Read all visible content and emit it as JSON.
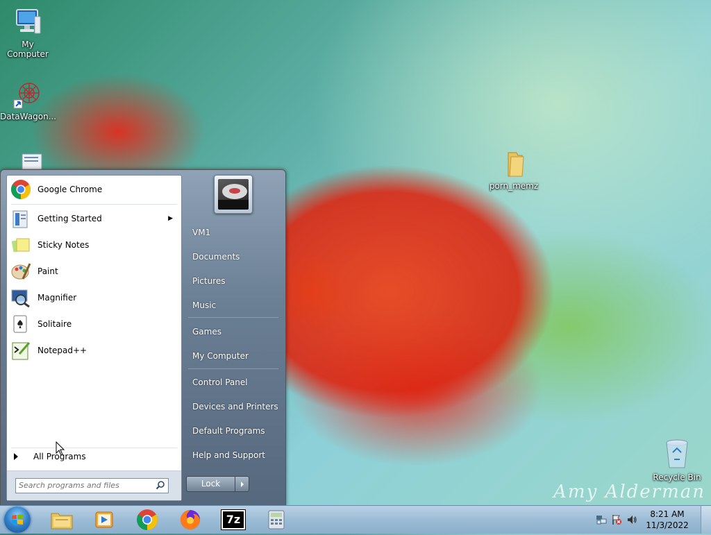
{
  "desktop": {
    "icons": [
      {
        "label": "My Computer",
        "icon": "computer-icon"
      },
      {
        "label": "DataWagon...",
        "icon": "datawagon-shortcut-icon"
      },
      {
        "label": "porn_memz",
        "icon": "folder-icon"
      },
      {
        "label": "Recycle Bin",
        "icon": "recycle-bin-icon"
      }
    ],
    "signature": "Amy Alderman"
  },
  "start_menu": {
    "pinned": [
      {
        "label": "Google Chrome",
        "icon": "chrome-icon"
      }
    ],
    "recent": [
      {
        "label": "Getting Started",
        "icon": "getting-started-icon",
        "has_submenu": true
      },
      {
        "label": "Sticky Notes",
        "icon": "sticky-notes-icon"
      },
      {
        "label": "Paint",
        "icon": "paint-icon"
      },
      {
        "label": "Magnifier",
        "icon": "magnifier-icon"
      },
      {
        "label": "Solitaire",
        "icon": "solitaire-icon"
      },
      {
        "label": "Notepad++",
        "icon": "notepad-plus-plus-icon"
      }
    ],
    "all_programs": "All Programs",
    "search_placeholder": "Search programs and files",
    "right_items": [
      "VM1",
      "Documents",
      "Pictures",
      "Music",
      "Games",
      "My Computer",
      "Control Panel",
      "Devices and Printers",
      "Default Programs",
      "Help and Support"
    ],
    "lock_label": "Lock"
  },
  "taskbar": {
    "pinned": [
      "file-explorer-icon",
      "media-player-icon",
      "chrome-icon",
      "firefox-icon",
      "7zip-icon",
      "calculator-icon"
    ],
    "seven_zip_text": "7z",
    "clock_time": "8:21 AM",
    "clock_date": "11/3/2022",
    "tray_icons": [
      "network-icon",
      "action-center-flag-icon",
      "volume-icon"
    ]
  }
}
